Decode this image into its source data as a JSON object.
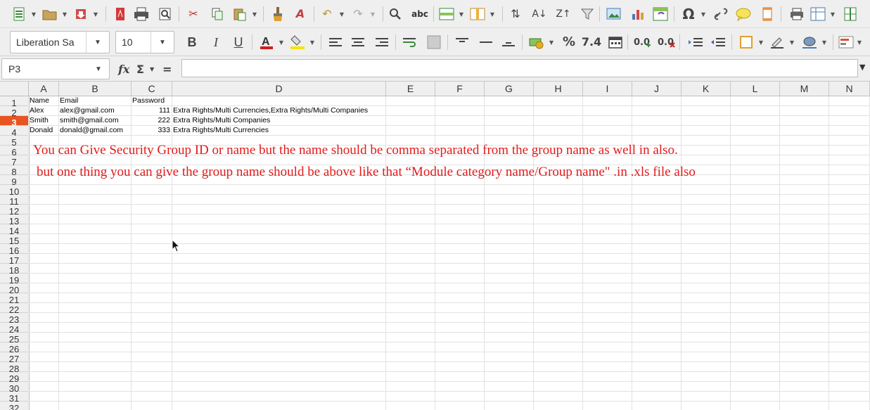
{
  "toolbar": {
    "font_name": "Liberation Sa",
    "font_size": "10",
    "number_format_decimal": "7.4",
    "number_format_percent": "%"
  },
  "formula_bar": {
    "name_box": "P3",
    "formula_value": ""
  },
  "columns": [
    {
      "label": "A"
    },
    {
      "label": "B"
    },
    {
      "label": "C"
    },
    {
      "label": "D"
    },
    {
      "label": "E"
    },
    {
      "label": "F"
    },
    {
      "label": "G"
    },
    {
      "label": "H"
    },
    {
      "label": "I"
    },
    {
      "label": "J"
    },
    {
      "label": "K"
    },
    {
      "label": "L"
    },
    {
      "label": "M"
    },
    {
      "label": "N"
    }
  ],
  "rows": [
    "1",
    "2",
    "3",
    "4",
    "5",
    "6",
    "7",
    "8",
    "9",
    "10",
    "11",
    "12",
    "13",
    "14",
    "15",
    "16",
    "17",
    "18",
    "19",
    "20",
    "21",
    "22",
    "23",
    "24",
    "25",
    "26",
    "27",
    "28",
    "29",
    "30",
    "31",
    "32"
  ],
  "selected_row": "3",
  "sheet": {
    "headers": [
      "Name",
      "Email",
      "Password"
    ],
    "records": [
      {
        "name": "Alex",
        "email": "alex@gmail.com",
        "password": "111",
        "groups": "Extra Rights/Multi Currencies,Extra Rights/Multi Companies"
      },
      {
        "name": "Smith",
        "email": "smith@gmail.com",
        "password": "222",
        "groups": "Extra Rights/Multi Companies"
      },
      {
        "name": "Donald",
        "email": "donald@gmail.com",
        "password": "333",
        "groups": "Extra Rights/Multi Currencies"
      }
    ]
  },
  "annotation": {
    "line1": "You can Give Security Group ID or name but the name should be comma separated from the group name as well in also.",
    "line2": "but one thing you can give the group name should be above like that “Module category name/Group name\" .in .xls file also",
    "color": "#e31a1a"
  },
  "colors": {
    "selected_row_header": "#e95420",
    "toolbar_bg": "#efefef"
  }
}
